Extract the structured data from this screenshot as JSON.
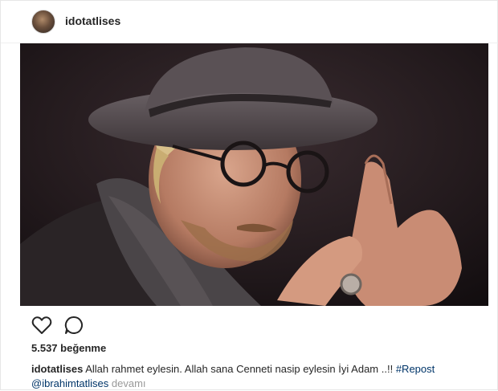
{
  "post": {
    "username": "idotatlises",
    "likes_text": "5.537 beğenme",
    "caption": {
      "username": "idotatlises",
      "text": "Allah rahmet eylesin. Allah sana Cenneti nasip eylesin İyi Adam ..!!",
      "hashtag": "#Repost",
      "mention": "@ibrahimtatlises",
      "more_label": "devamı"
    }
  },
  "icons": {
    "like": "heart-outline-icon",
    "comment": "speech-bubble-icon"
  },
  "colors": {
    "text": "#262626",
    "link": "#003569",
    "muted": "#999999",
    "border": "#efefef"
  }
}
